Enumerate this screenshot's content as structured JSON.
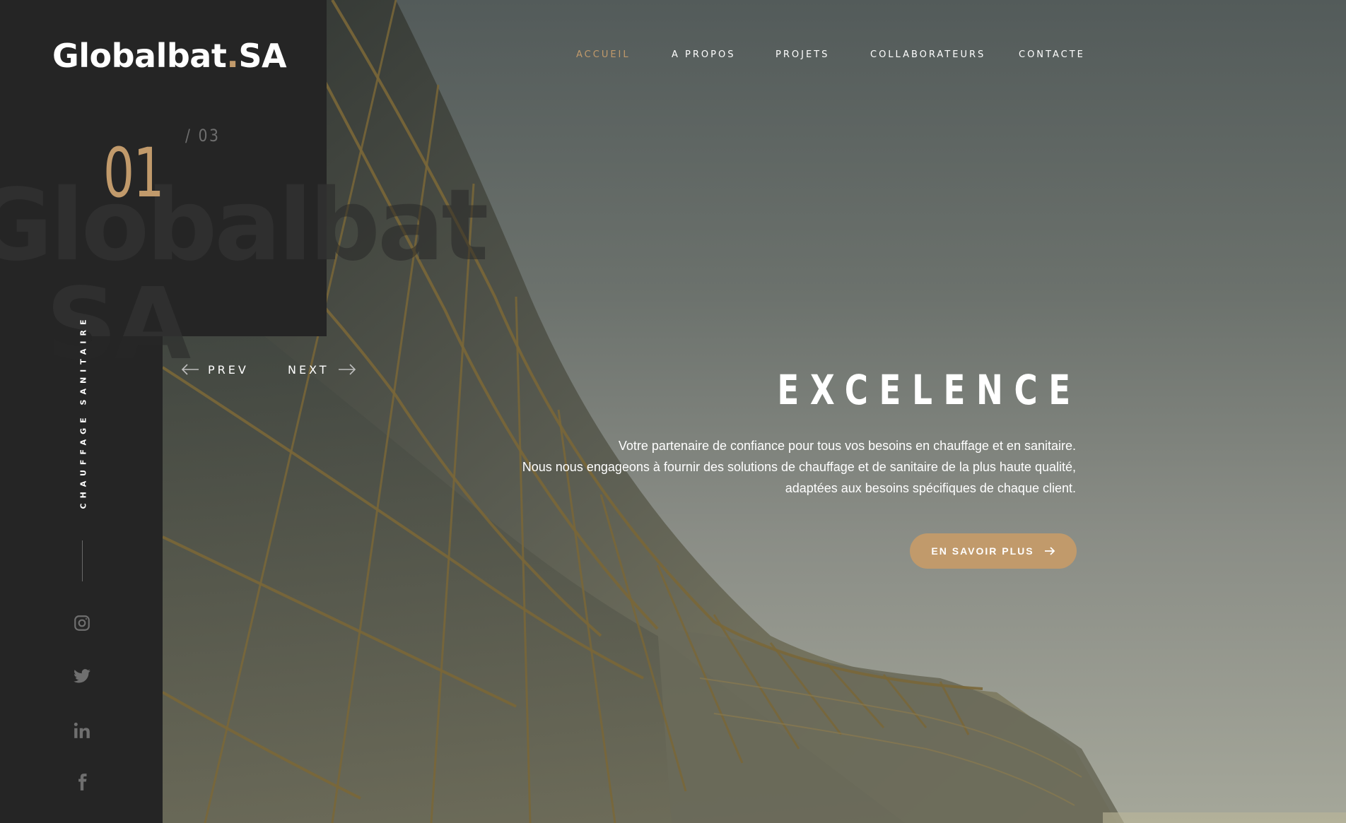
{
  "brand": {
    "name": "Globalbat",
    "dot": ".",
    "suffix": "SA",
    "watermark_line1": "Globalbat",
    "watermark_line2": "SA"
  },
  "slider": {
    "current": "01",
    "total": "/  03",
    "prev_label": "PREV",
    "next_label": "NEXT"
  },
  "sidebar": {
    "tagline": "CHAUFFAGE SANITAIRE"
  },
  "social": [
    {
      "icon": "instagram-icon"
    },
    {
      "icon": "twitter-icon"
    },
    {
      "icon": "linkedin-icon"
    },
    {
      "icon": "facebook-icon"
    }
  ],
  "nav": {
    "items": [
      {
        "label": "ACCUEIL",
        "active": true
      },
      {
        "label": "A PROPOS",
        "active": false
      },
      {
        "label": "PROJETS",
        "active": false
      },
      {
        "label": "COLLABORATEURS",
        "active": false
      },
      {
        "label": "CONTACTE",
        "active": false
      }
    ]
  },
  "hero": {
    "title": "EXCELENCE",
    "lines": [
      "Votre partenaire de confiance pour tous vos besoins en chauffage et en sanitaire.",
      "Nous nous engageons à fournir des solutions de chauffage et de sanitaire de la plus haute qualité,",
      "adaptées aux besoins spécifiques de chaque client."
    ],
    "cta_label": "EN SAVOIR PLUS"
  },
  "colors": {
    "accent": "#c19a6b",
    "dark": "#252525",
    "text": "#ffffff"
  }
}
